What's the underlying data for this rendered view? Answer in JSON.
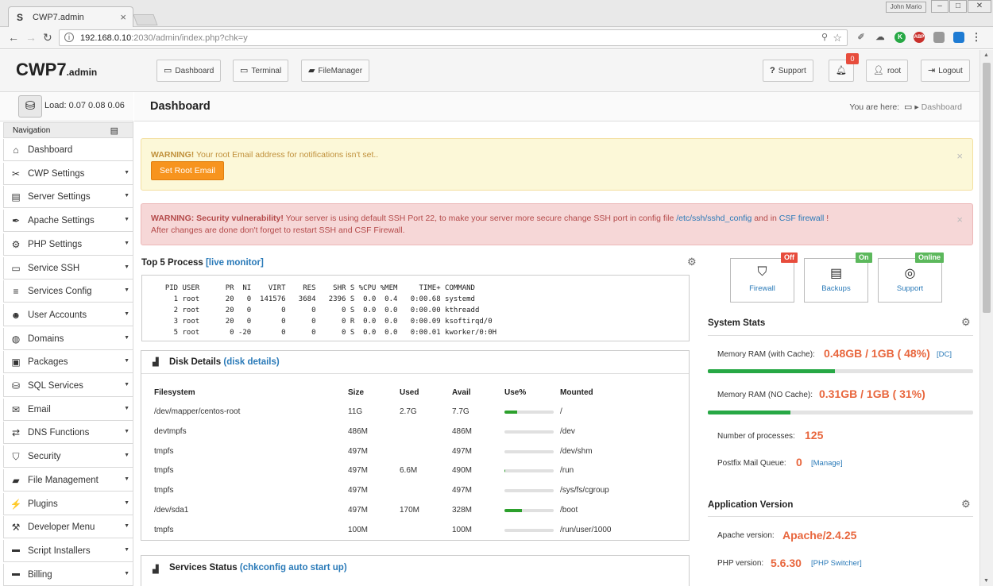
{
  "browser": {
    "tab_title": "CWP7.admin",
    "tab_favicon": "S",
    "window_user": "John Mario",
    "url_host": "192.168.0.10",
    "url_path": ":2030/admin/index.php?chk=y"
  },
  "header": {
    "brand": "CWP7",
    "brand_suffix": ".admin",
    "buttons": {
      "dashboard": "Dashboard",
      "terminal": "Terminal",
      "filemanager": "FileManager",
      "support": "Support",
      "user": "root",
      "logout": "Logout"
    },
    "notification_count": "0"
  },
  "sidebar": {
    "load_text": "Load: 0.07  0.08  0.06",
    "nav_heading": "Navigation",
    "items": [
      {
        "label": "Dashboard",
        "icon": "home-icon"
      },
      {
        "label": "CWP Settings",
        "icon": "wrench-icon"
      },
      {
        "label": "Server Settings",
        "icon": "server-icon"
      },
      {
        "label": "Apache Settings",
        "icon": "feather-icon"
      },
      {
        "label": "PHP Settings",
        "icon": "gear-icon"
      },
      {
        "label": "Service SSH",
        "icon": "monitor-icon"
      },
      {
        "label": "Services Config",
        "icon": "list-icon"
      },
      {
        "label": "User Accounts",
        "icon": "user-icon"
      },
      {
        "label": "Domains",
        "icon": "globe-icon"
      },
      {
        "label": "Packages",
        "icon": "box-icon"
      },
      {
        "label": "SQL Services",
        "icon": "database-icon"
      },
      {
        "label": "Email",
        "icon": "envelope-icon"
      },
      {
        "label": "DNS Functions",
        "icon": "dns-icon"
      },
      {
        "label": "Security",
        "icon": "shield-icon"
      },
      {
        "label": "File Management",
        "icon": "folder-icon"
      },
      {
        "label": "Plugins",
        "icon": "plug-icon"
      },
      {
        "label": "Developer Menu",
        "icon": "hammer-icon"
      },
      {
        "label": "Script Installers",
        "icon": "new-badge-icon"
      },
      {
        "label": "Billing",
        "icon": "new-badge-icon"
      }
    ]
  },
  "page": {
    "title": "Dashboard",
    "breadcrumb_prefix": "You are here:",
    "breadcrumb_current": "Dashboard"
  },
  "alerts": {
    "email_warning_strong": "WARNING!",
    "email_warning_text": " Your root Email address for notifications isn't set..",
    "email_button": "Set Root Email",
    "security_strong": "WARNING: Security vulnerability!",
    "security_text_1": " Your server is using default SSH Port 22, to make your server more secure change SSH port in config file ",
    "security_link_1": "/etc/ssh/sshd_config",
    "security_text_2": " and in ",
    "security_link_2": "CSF firewall",
    "security_text_3": " !",
    "security_line_2": "After changes are done don't forget to restart SSH and CSF Firewall.",
    "close": "×"
  },
  "processes": {
    "title": "Top 5 Process ",
    "link": "[live monitor]",
    "output": "  PID USER      PR  NI    VIRT    RES    SHR S %CPU %MEM     TIME+ COMMAND\n    1 root      20   0  141576   3684   2396 S  0.0  0.4   0:00.68 systemd\n    2 root      20   0       0      0      0 S  0.0  0.0   0:00.00 kthreadd\n    3 root      20   0       0      0      0 R  0.0  0.0   0:00.09 ksoftirqd/0\n    5 root       0 -20       0      0      0 S  0.0  0.0   0:00.01 kworker/0:0H"
  },
  "disk": {
    "title": "Disk Details ",
    "link": "(disk details)",
    "headers": [
      "Filesystem",
      "Size",
      "Used",
      "Avail",
      "Use%",
      "Mounted"
    ],
    "rows": [
      {
        "fs": "/dev/mapper/centos-root",
        "size": "11G",
        "used": "2.7G",
        "avail": "7.7G",
        "use": 26,
        "mount": "/"
      },
      {
        "fs": "devtmpfs",
        "size": "486M",
        "used": "",
        "avail": "486M",
        "use": 0,
        "mount": "/dev"
      },
      {
        "fs": "tmpfs",
        "size": "497M",
        "used": "",
        "avail": "497M",
        "use": 0,
        "mount": "/dev/shm"
      },
      {
        "fs": "tmpfs",
        "size": "497M",
        "used": "6.6M",
        "avail": "490M",
        "use": 2,
        "mount": "/run"
      },
      {
        "fs": "tmpfs",
        "size": "497M",
        "used": "",
        "avail": "497M",
        "use": 0,
        "mount": "/sys/fs/cgroup"
      },
      {
        "fs": "/dev/sda1",
        "size": "497M",
        "used": "170M",
        "avail": "328M",
        "use": 35,
        "mount": "/boot"
      },
      {
        "fs": "tmpfs",
        "size": "100M",
        "used": "",
        "avail": "100M",
        "use": 0,
        "mount": "/run/user/1000"
      }
    ]
  },
  "services": {
    "title": "Services Status ",
    "link": "(chkconfig auto start up)"
  },
  "quick": {
    "firewall": {
      "label": "Firewall",
      "badge": "Off",
      "color": "#e74c3c"
    },
    "backups": {
      "label": "Backups",
      "badge": "On",
      "color": "#5cb85c"
    },
    "support": {
      "label": "Support",
      "badge": "Online",
      "color": "#5cb85c"
    }
  },
  "stats": {
    "title": "System Stats",
    "mem_cache_label": "Memory RAM (with Cache):",
    "mem_cache_value": "0.48GB / 1GB ( 48%)",
    "mem_cache_pct": 48,
    "mem_cache_link": "[DC]",
    "mem_nocache_label": "Memory RAM (NO Cache):",
    "mem_nocache_value": "0.31GB / 1GB ( 31%)",
    "mem_nocache_pct": 31,
    "proc_label": "Number of processes:",
    "proc_value": "125",
    "mail_label": "Postfix Mail Queue:",
    "mail_value": "0",
    "mail_link": "[Manage]"
  },
  "appversion": {
    "title": "Application Version",
    "apache_label": "Apache version:",
    "apache_value": "Apache/2.4.25",
    "php_label": "PHP version:",
    "php_value": "5.6.30",
    "php_link": "[PHP Switcher]"
  }
}
